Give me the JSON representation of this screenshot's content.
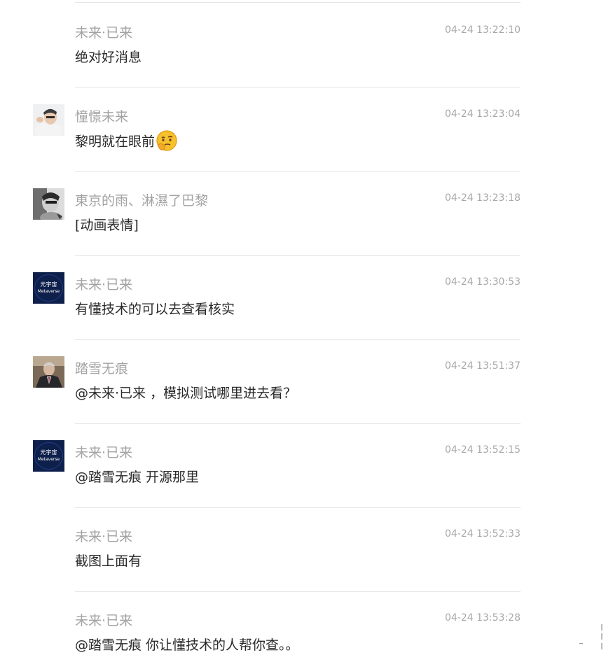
{
  "comments": [
    {
      "user": "未来·已来",
      "time": "04-24 13:22:10",
      "text": "绝对好消息",
      "avatar": "none"
    },
    {
      "user": "憧憬未来",
      "time": "04-24 13:23:04",
      "text": "黎明就在眼前",
      "emoji": "thinking-emoji",
      "avatar": "person-photo"
    },
    {
      "user": "東京的雨、淋濕了巴黎",
      "time": "04-24 13:23:18",
      "text": "[动画表情]",
      "avatar": "grayscale-photo"
    },
    {
      "user": "未来·已来",
      "time": "04-24 13:30:53",
      "text": "有懂技术的可以去查看核实",
      "avatar": "metaverse-logo",
      "avatar_text_cn": "元宇宙",
      "avatar_text_en": "Metaverse"
    },
    {
      "user": "踏雪无痕",
      "time": "04-24 13:51:37",
      "text": "@未来·已来 ，模拟测试哪里进去看？",
      "avatar": "suit-photo"
    },
    {
      "user": "未来·已来",
      "time": "04-24 13:52:15",
      "text": "@踏雪无痕 开源那里",
      "avatar": "metaverse-logo",
      "avatar_text_cn": "元宇宙",
      "avatar_text_en": "Metaverse"
    },
    {
      "user": "未来·已来",
      "time": "04-24 13:52:33",
      "text": "截图上面有",
      "avatar": "none"
    },
    {
      "user": "未来·已来",
      "time": "04-24 13:53:28",
      "text": "@踏雪无痕 你让懂技术的人帮你查。。",
      "avatar": "none"
    }
  ],
  "colors": {
    "username": "#a3a3a3",
    "timestamp": "#a8a8a8",
    "message": "#2a2a2a",
    "divider": "#e6e6e6",
    "metaverse_bg": "#0d1f4a"
  }
}
